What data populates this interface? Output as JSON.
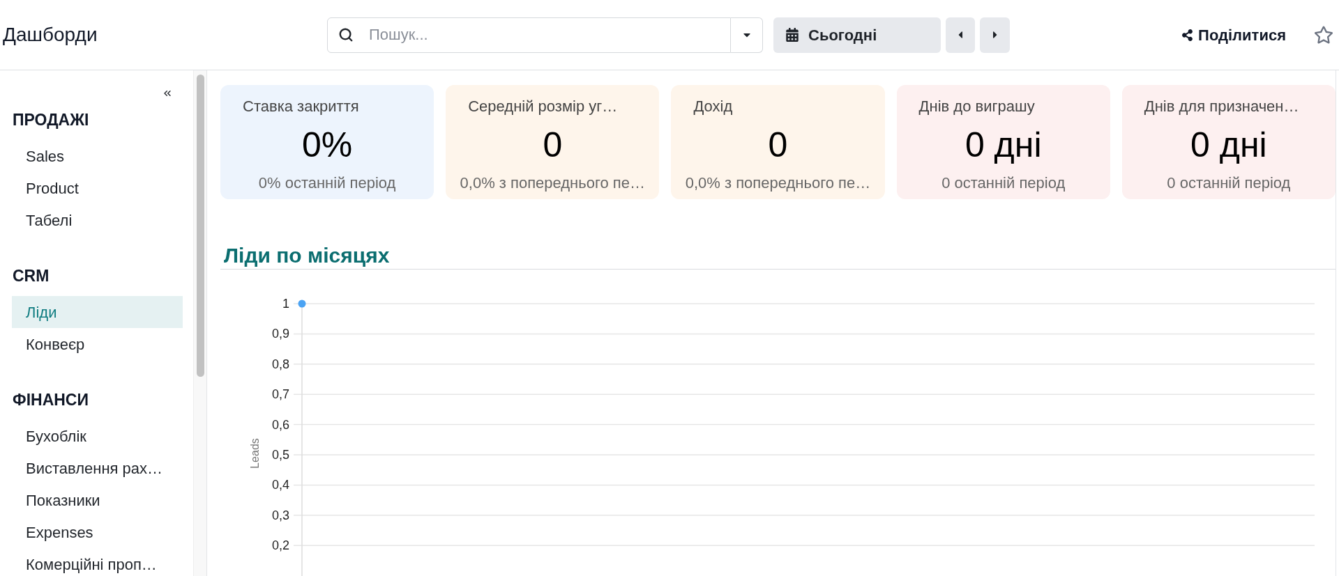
{
  "header": {
    "title": "Дашборди",
    "search": {
      "placeholder": "Пошук..."
    },
    "date_filter": {
      "label": "Сьогодні"
    },
    "share": {
      "label": "Поділитися"
    },
    "favorite": {
      "starred": false
    }
  },
  "sidebar": {
    "sections": [
      {
        "title": "ПРОДАЖІ",
        "items": [
          {
            "label": "Sales",
            "selected": false
          },
          {
            "label": "Product",
            "selected": false
          },
          {
            "label": "Табелі",
            "selected": false
          }
        ]
      },
      {
        "title": "CRM",
        "items": [
          {
            "label": "Ліди",
            "selected": true
          },
          {
            "label": "Конвеєр",
            "selected": false
          }
        ]
      },
      {
        "title": "ФІНАНСИ",
        "items": [
          {
            "label": "Бухоблік",
            "selected": false
          },
          {
            "label": "Виставлення рах…",
            "selected": false
          },
          {
            "label": "Показники",
            "selected": false
          },
          {
            "label": "Expenses",
            "selected": false
          },
          {
            "label": "Комерційні проп…",
            "selected": false
          }
        ]
      }
    ]
  },
  "kpis": [
    {
      "title": "Ставка закриття",
      "value": "0%",
      "comparison": "0% останній період",
      "color": "#edf4fd"
    },
    {
      "title": "Середній розмір уг…",
      "value": "0",
      "comparison": "0,0% з попереднього пе…",
      "color": "#fef5eb"
    },
    {
      "title": "Дохід",
      "value": "0",
      "comparison": "0,0% з попереднього пе…",
      "color": "#fef5eb"
    },
    {
      "title": "Днів до виграшу",
      "value": "0 дні",
      "comparison": "0 останній період",
      "color": "#fdf0f0"
    },
    {
      "title": "Днів для призначен…",
      "value": "0 дні",
      "comparison": "0 останній період",
      "color": "#fdf0f0"
    }
  ],
  "leads_chart": {
    "title": "Ліди по місяцях",
    "y_axis_title": "Leads",
    "y_tick_labels": [
      "1",
      "0,9",
      "0,8",
      "0,7",
      "0,6",
      "0,5",
      "0,4",
      "0,3",
      "0,2"
    ]
  }
}
